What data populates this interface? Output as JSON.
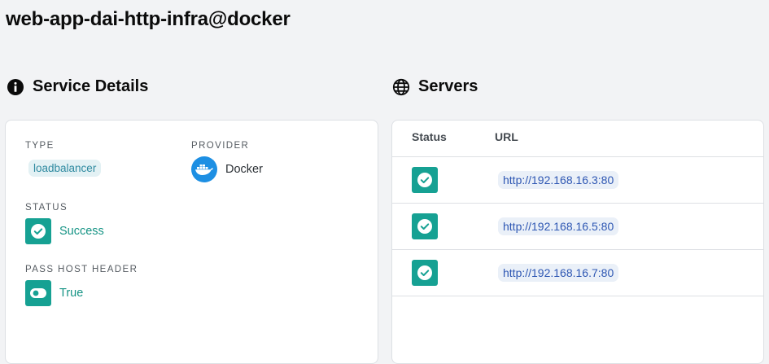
{
  "page": {
    "title": "web-app-dai-http-infra@docker"
  },
  "service_details": {
    "heading": "Service Details",
    "heading_icon": "info-icon",
    "type_label": "TYPE",
    "type_value": "loadbalancer",
    "provider_label": "PROVIDER",
    "provider_value": "Docker",
    "provider_icon": "docker-icon",
    "status_label": "STATUS",
    "status_value": "Success",
    "status_icon": "check-circle-icon",
    "pass_host_header_label": "PASS HOST HEADER",
    "pass_host_header_value": "True",
    "pass_host_header_icon": "toggle-on-icon"
  },
  "servers": {
    "heading": "Servers",
    "heading_icon": "globe-icon",
    "columns": {
      "status": "Status",
      "url": "URL"
    },
    "rows": [
      {
        "status": "success",
        "url": "http://192.168.16.3:80"
      },
      {
        "status": "success",
        "url": "http://192.168.16.5:80"
      },
      {
        "status": "success",
        "url": "http://192.168.16.7:80"
      }
    ]
  },
  "colors": {
    "success": "#16a193",
    "type_chip_bg": "#e3f1f4",
    "url_chip_bg": "#eaf0f8",
    "docker_blue": "#1d8fe3"
  }
}
